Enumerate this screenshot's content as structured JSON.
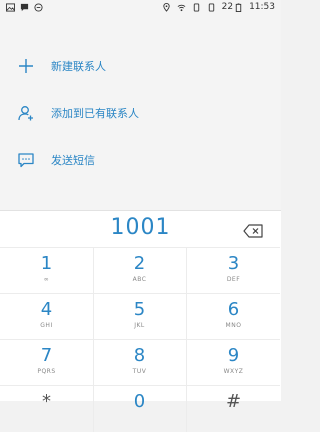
{
  "status_bar": {
    "battery": "22",
    "time": "11:53"
  },
  "actions": [
    {
      "label": "新建联系人",
      "icon": "plus-icon"
    },
    {
      "label": "添加到已有联系人",
      "icon": "add-contact-icon"
    },
    {
      "label": "发送短信",
      "icon": "message-icon"
    }
  ],
  "dial": {
    "number": "1001"
  },
  "keys": [
    {
      "num": "1",
      "sub": "∞"
    },
    {
      "num": "2",
      "sub": "ABC"
    },
    {
      "num": "3",
      "sub": "DEF"
    },
    {
      "num": "4",
      "sub": "GHI"
    },
    {
      "num": "5",
      "sub": "JKL"
    },
    {
      "num": "6",
      "sub": "MNO"
    },
    {
      "num": "7",
      "sub": "PQRS"
    },
    {
      "num": "8",
      "sub": "TUV"
    },
    {
      "num": "9",
      "sub": "WXYZ"
    },
    {
      "num": "*",
      "sub": ""
    },
    {
      "num": "0",
      "sub": ""
    },
    {
      "num": "#",
      "sub": ""
    }
  ],
  "colors": {
    "accent": "#2b86c5"
  }
}
